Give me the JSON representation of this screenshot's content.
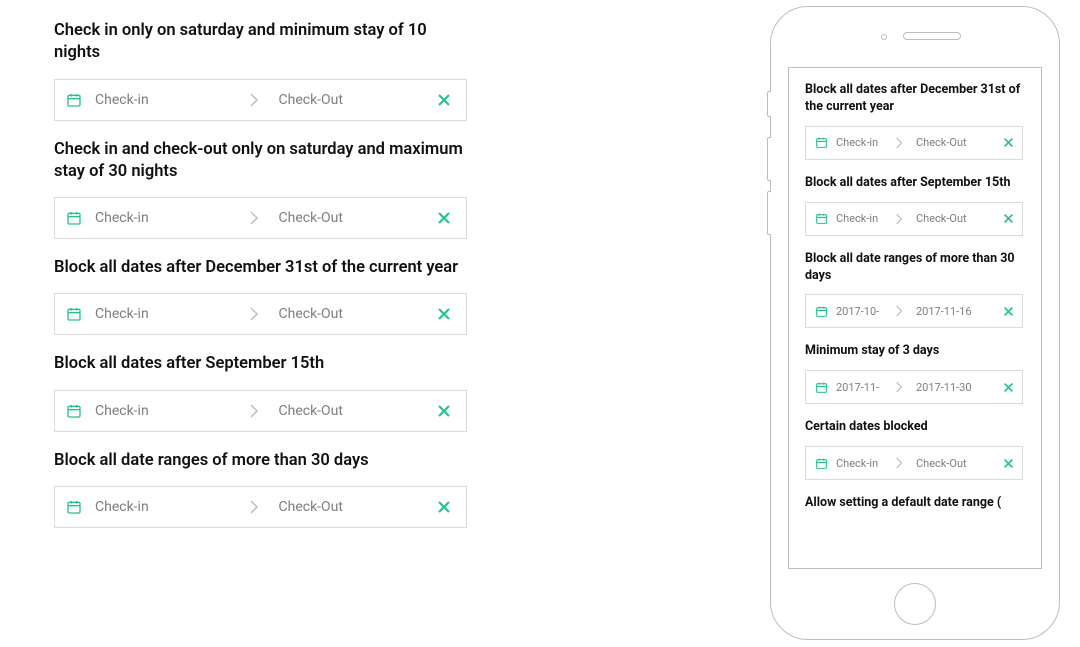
{
  "left": [
    {
      "title": "Check in only on saturday and minimum stay of 10 nights",
      "checkin": "Check-in",
      "checkout": "Check-Out"
    },
    {
      "title": "Check in and check-out only on saturday and maximum stay of 30 nights",
      "checkin": "Check-in",
      "checkout": "Check-Out"
    },
    {
      "title": "Block all dates after December 31st of the current year",
      "checkin": "Check-in",
      "checkout": "Check-Out"
    },
    {
      "title": "Block all dates after September 15th",
      "checkin": "Check-in",
      "checkout": "Check-Out"
    },
    {
      "title": "Block all date ranges of more than 30 days",
      "checkin": "Check-in",
      "checkout": "Check-Out"
    }
  ],
  "mobile": [
    {
      "title": "Block all dates after December 31st of the current year",
      "checkin": "Check-in",
      "checkout": "Check-Out"
    },
    {
      "title": "Block all dates after September 15th",
      "checkin": "Check-in",
      "checkout": "Check-Out"
    },
    {
      "title": "Block all date ranges of more than 30 days",
      "checkin": "2017-10-",
      "checkout": "2017-11-16"
    },
    {
      "title": "Minimum stay of 3 days",
      "checkin": "2017-11-",
      "checkout": "2017-11-30"
    },
    {
      "title": "Certain dates blocked",
      "checkin": "Check-in",
      "checkout": "Check-Out"
    },
    {
      "title": "Allow setting a default date range (",
      "checkin": "",
      "checkout": ""
    }
  ],
  "colors": {
    "accent": "#25c48f",
    "border": "#d9dcde",
    "text_muted": "#7a7f84"
  }
}
